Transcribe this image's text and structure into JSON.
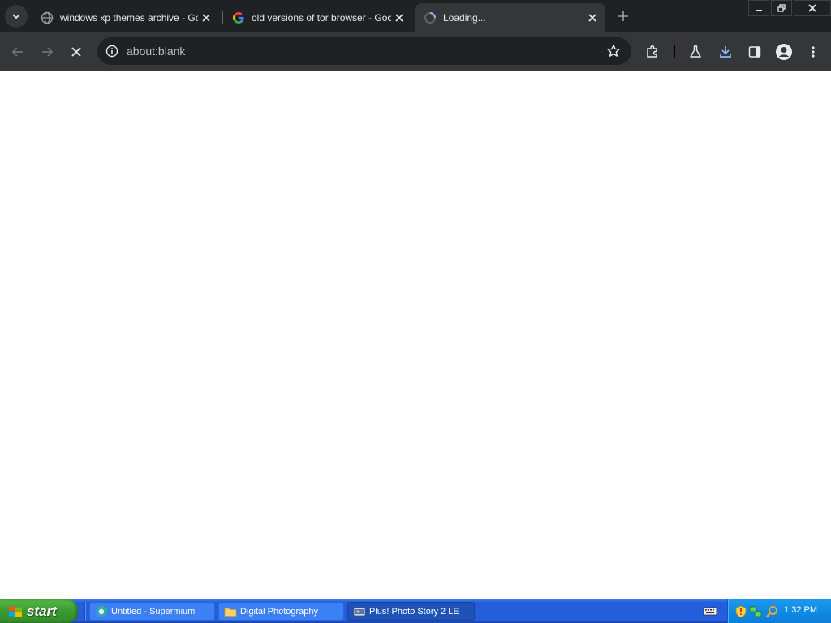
{
  "browser": {
    "tabs": [
      {
        "title": "windows xp themes archive - Goog",
        "favicon": "globe-icon",
        "active": false
      },
      {
        "title": "old versions of tor browser - Googl",
        "favicon": "google-icon",
        "active": false
      },
      {
        "title": "Loading...",
        "favicon": "loading-spinner-icon",
        "active": true
      }
    ],
    "address": "about:blank"
  },
  "taskbar": {
    "start_label": "start",
    "tasks": [
      {
        "label": "Untitled - Supermium",
        "icon": "supermium-icon"
      },
      {
        "label": "Digital Photography",
        "icon": "folder-icon"
      },
      {
        "label": "Plus! Photo Story 2 LE",
        "icon": "photostory-icon"
      }
    ],
    "clock": "1:32 PM"
  },
  "colors": {
    "tabstrip_bg": "#202124",
    "toolbar_bg": "#35363a",
    "omnibox_bg": "#202124",
    "taskbar_blue": "#245edc",
    "start_green": "#3a9a31",
    "tray_blue": "#0f8be5",
    "download_accent": "#8ab4f8"
  }
}
